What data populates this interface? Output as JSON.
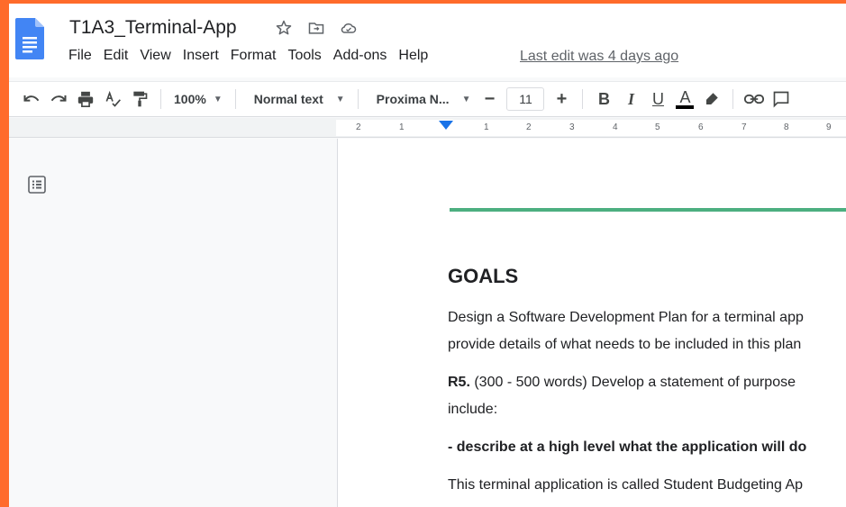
{
  "app": {
    "doc_title": "T1A3_Terminal-App",
    "last_edit": "Last edit was 4 days ago"
  },
  "menu": [
    "File",
    "Edit",
    "View",
    "Insert",
    "Format",
    "Tools",
    "Add-ons",
    "Help"
  ],
  "toolbar": {
    "zoom": "100%",
    "style": "Normal text",
    "font": "Proxima N...",
    "font_size": "11",
    "bold": "B",
    "italic": "I",
    "underline": "U",
    "text_color": "A"
  },
  "ruler": {
    "labels": [
      "2",
      "1",
      "1",
      "2",
      "3",
      "4",
      "5",
      "6",
      "7",
      "8",
      "9"
    ]
  },
  "document": {
    "heading": "GOALS",
    "p1_line1": "Design a Software Development Plan for a terminal app",
    "p1_line2": "provide details of what needs to be included in this plan",
    "r5_label": "R5.",
    "r5_text": " (300 - 500 words) Develop a statement of purpose",
    "r5_line2": "include:",
    "bullet": "- describe at a high level what the application will do",
    "p3": "This terminal application is called Student Budgeting Ap"
  },
  "colors": {
    "accent_border": "#ff6b2b",
    "doc_blue": "#4285f4",
    "green_rule": "#4caf80"
  }
}
